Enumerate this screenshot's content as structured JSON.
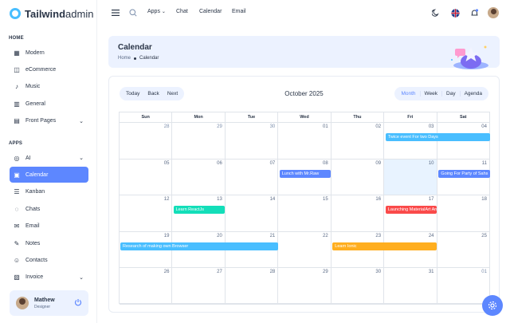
{
  "brand": {
    "name_bold": "Tailwind",
    "name_rest": "admin"
  },
  "sidebar": {
    "sections": [
      {
        "label": "HOME",
        "items": [
          {
            "label": "Modern",
            "icon": "grid-icon"
          },
          {
            "label": "eCommerce",
            "icon": "bag-icon"
          },
          {
            "label": "Music",
            "icon": "music-icon"
          },
          {
            "label": "General",
            "icon": "chart-icon"
          },
          {
            "label": "Front Pages",
            "icon": "page-icon",
            "chevron": true
          }
        ]
      },
      {
        "label": "APPS",
        "items": [
          {
            "label": "AI",
            "icon": "ai-icon",
            "chevron": true
          },
          {
            "label": "Calendar",
            "icon": "calendar-icon",
            "active": true
          },
          {
            "label": "Kanban",
            "icon": "kanban-icon"
          },
          {
            "label": "Chats",
            "icon": "chat-icon"
          },
          {
            "label": "Email",
            "icon": "mail-icon"
          },
          {
            "label": "Notes",
            "icon": "notes-icon"
          },
          {
            "label": "Contacts",
            "icon": "contacts-icon"
          },
          {
            "label": "Invoice",
            "icon": "invoice-icon",
            "chevron": true
          }
        ]
      }
    ],
    "user": {
      "name": "Mathew",
      "role": "Designer"
    }
  },
  "topbar": {
    "apps": "Apps",
    "chat": "Chat",
    "calendar": "Calendar",
    "email": "Email"
  },
  "header": {
    "title": "Calendar",
    "crumb_home": "Home",
    "crumb_current": "Calendar"
  },
  "calendar": {
    "title": "October 2025",
    "nav": [
      "Today",
      "Back",
      "Next"
    ],
    "views": [
      "Month",
      "Week",
      "Day",
      "Agenda"
    ],
    "active_view": "Month",
    "weekdays": [
      "Sun",
      "Mon",
      "Tue",
      "Wed",
      "Thu",
      "Fri",
      "Sat"
    ],
    "weeks": [
      [
        "28",
        "29",
        "30",
        "01",
        "02",
        "03",
        "04"
      ],
      [
        "05",
        "06",
        "07",
        "08",
        "09",
        "10",
        "11"
      ],
      [
        "12",
        "13",
        "14",
        "15",
        "16",
        "17",
        "18"
      ],
      [
        "19",
        "20",
        "21",
        "22",
        "23",
        "24",
        "25"
      ],
      [
        "26",
        "27",
        "28",
        "29",
        "30",
        "31",
        "01"
      ]
    ],
    "other_month": [
      [
        0,
        0
      ],
      [
        0,
        1
      ],
      [
        0,
        2
      ],
      [
        4,
        6
      ]
    ],
    "today": [
      1,
      5
    ],
    "events": [
      {
        "title": "Twice event For two Days",
        "week": 0,
        "start": 5,
        "span": 2,
        "color": "#49beff"
      },
      {
        "title": "Lunch with Mr.Raw",
        "week": 1,
        "start": 3,
        "span": 1,
        "color": "#5d87ff"
      },
      {
        "title": "Going For Party of Sahs",
        "week": 1,
        "start": 6,
        "span": 1,
        "color": "#5d87ff"
      },
      {
        "title": "Learn ReactJs",
        "week": 2,
        "start": 1,
        "span": 1,
        "color": "#13deb9"
      },
      {
        "title": "Launching MaterialArt Angular",
        "week": 2,
        "start": 5,
        "span": 1,
        "color": "#fa4a4a"
      },
      {
        "title": "Research of making own Browser",
        "week": 3,
        "start": 0,
        "span": 3,
        "color": "#49beff"
      },
      {
        "title": "Learn Ionic",
        "week": 3,
        "start": 4,
        "span": 2,
        "color": "#ffae1f"
      }
    ]
  }
}
